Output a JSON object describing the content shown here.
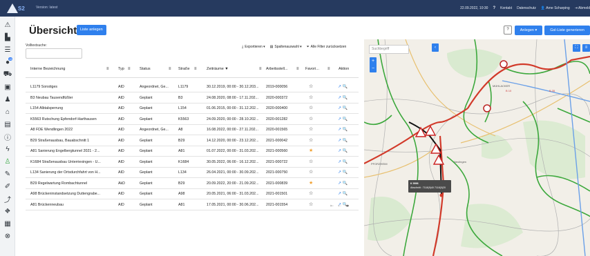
{
  "topbar": {
    "logo_text": "S2",
    "version": "Version: latest",
    "datetime": "22.09.2022, 10:30",
    "help": "?",
    "links": [
      "Kontakt",
      "Datenschutz"
    ],
    "user": "Arne Scharping",
    "logout": "Abmeld"
  },
  "sidebar": {
    "badge": "15"
  },
  "header": {
    "title": "Übersicht",
    "title_caret": "▾",
    "create_list_button": "Liste anlegen",
    "help_button": "?",
    "create_button": "Anlegen ▾",
    "gsl_button": "Gsl-Liste generieren"
  },
  "search": {
    "label": "Volltextsuche:",
    "value": "",
    "placeholder": ""
  },
  "toolbar": {
    "export": "Exportieren ▾",
    "columns": "Spaltenauswahl ▾",
    "reset": "Alle Filter zurücksetzen"
  },
  "table": {
    "headers": [
      "Interne Bezeichnung",
      "Typ",
      "Status",
      "Straße",
      "Zeiträume ▼",
      "Arbeitsstell...",
      "Favori...",
      "Aktion"
    ],
    "rows": [
      {
        "name": "L1179 Sonstiges",
        "typ": "AID",
        "status": "Angeordnet, Ge...",
        "strasse": "L1179",
        "zeitraum": "30.12.2019, 00:00 - 30.12.203...",
        "nr": "2019-000056",
        "fav": "☆",
        "fav_color": "#222"
      },
      {
        "name": "B3 Neubau Tausendfüßler",
        "typ": "AID",
        "status": "Geplant",
        "strasse": "B3",
        "zeitraum": "24.08.2020, 08:00 - 17.11.202...",
        "nr": "2020-000372",
        "fav": "☆",
        "fav_color": "#222"
      },
      {
        "name": "L154 Albtalsperrung",
        "typ": "AID",
        "status": "Geplant",
        "strasse": "L154",
        "zeitraum": "01.06.2015, 00:00 - 31.12.202...",
        "nr": "2020-000400",
        "fav": "☆",
        "fav_color": "#222"
      },
      {
        "name": "K5563 Rutschung Epfendorf-Harthausen",
        "typ": "AID",
        "status": "Geplant",
        "strasse": "K5563",
        "zeitraum": "24.09.2020, 00:00 - 28.10.202...",
        "nr": "2020-001282",
        "fav": "☆",
        "fav_color": "#222"
      },
      {
        "name": "A8 FDE Wendlingen 2022",
        "typ": "AID",
        "status": "Angeordnet, Ge...",
        "strasse": "A8",
        "zeitraum": "16.08.2022, 00:00 - 27.11.202...",
        "nr": "2020-001565",
        "fav": "☆",
        "fav_color": "#222"
      },
      {
        "name": "B29 Straßenausbau, Bauabschnitt 1",
        "typ": "AID",
        "status": "Geplant",
        "strasse": "B29",
        "zeitraum": "14.12.2020, 00:00 - 23.12.202...",
        "nr": "2021-000042",
        "fav": "☆",
        "fav_color": "#222"
      },
      {
        "name": "A81 Sanierung Engelbergtunnel 2021 - 2...",
        "typ": "AID",
        "status": "Geplant",
        "strasse": "A81",
        "zeitraum": "01.07.2022, 00:00 - 31.03.202...",
        "nr": "2021-000560",
        "fav": "★",
        "fav_color": "#f0a030"
      },
      {
        "name": "K1684 Straßenausbau Unterriexingen - U...",
        "typ": "AID",
        "status": "Geplant",
        "strasse": "K1684",
        "zeitraum": "30.05.2022, 06:00 - 16.12.202...",
        "nr": "2021-000722",
        "fav": "☆",
        "fav_color": "#222"
      },
      {
        "name": "L134 Sanierung der Ortsdurchfahrt von H...",
        "typ": "AID",
        "status": "Geplant",
        "strasse": "L134",
        "zeitraum": "26.04.2021, 00:00 - 30.09.202...",
        "nr": "2021-000750",
        "fav": "☆",
        "fav_color": "#222"
      },
      {
        "name": "B29 Regelwartung Rombachtunnel",
        "typ": "AkD",
        "status": "Geplant",
        "strasse": "B29",
        "zeitraum": "20.09.2022, 20:00 - 21.09.202...",
        "nr": "2021-000839",
        "fav": "★",
        "fav_color": "#f0a030"
      },
      {
        "name": "A98 Brückeninstandsetzung Duttengrabe...",
        "typ": "AID",
        "status": "Geplant",
        "strasse": "A98",
        "zeitraum": "20.05.2021, 06:00 - 31.03.202...",
        "nr": "2021-001501",
        "fav": "☆",
        "fav_color": "#222"
      },
      {
        "name": "A81 Brückenneubau",
        "typ": "AID",
        "status": "Geplant",
        "strasse": "A81",
        "zeitraum": "17.05.2021, 00:00 - 30.06.202...",
        "nr": "2021-001554",
        "fav": "☆",
        "fav_color": "#222"
      }
    ],
    "action_icons": "↗ 🔍"
  },
  "pager": {
    "first": "⇤",
    "prev": "⇠",
    "next": "➔"
  },
  "map": {
    "search_placeholder": "Suchbegriff",
    "zoom": "+ −",
    "collapse": "‹",
    "tooltip_line1": "K 9996",
    "tooltip_line2": "Abschnitt : 7118(9)40 7118(0)20",
    "place_labels": [
      "MÜHLACKER",
      "PFORZHEIM",
      "Neulingen"
    ],
    "road_labels": [
      "B 10",
      "B 35"
    ]
  }
}
